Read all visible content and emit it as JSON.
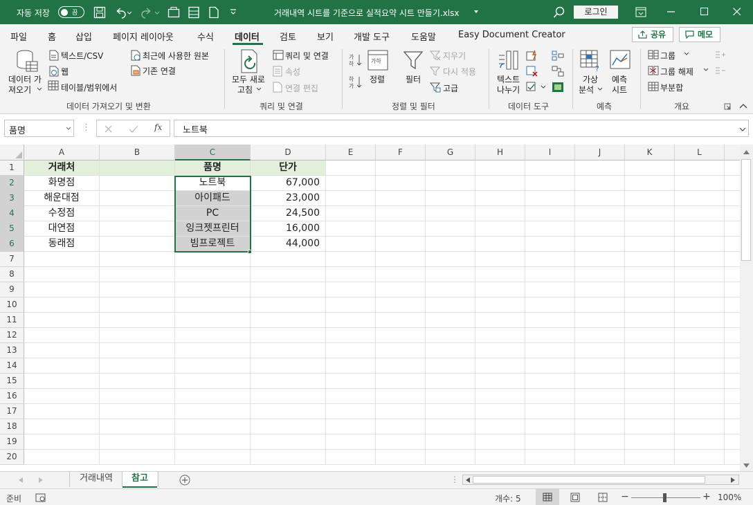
{
  "titlebar": {
    "autosave_label": "자동 저장",
    "toggle_label": "끔",
    "file_title": "거래내역 시트를 기준으로 실적요약 시트 만들기.xlsx",
    "login_label": "로그인"
  },
  "tabs": [
    "파일",
    "홈",
    "삽입",
    "페이지 레이아웃",
    "수식",
    "데이터",
    "검토",
    "보기",
    "개발 도구",
    "도움말",
    "Easy Document Creator"
  ],
  "active_tab": "데이터",
  "share_label": "공유",
  "memo_label": "메모",
  "ribbon": {
    "get_data": [
      "데이터 가",
      "져오기"
    ],
    "from_text": "텍스트/CSV",
    "from_web": "웹",
    "from_table": "테이블/범위에서",
    "recent_sources": "최근에 사용한 원본",
    "existing_connections": "기존 연결",
    "group_get": "데이터 가져오기 및 변환",
    "refresh_all": [
      "모두 새로",
      "고침"
    ],
    "queries_connections": "쿼리 및 연결",
    "properties": "속성",
    "edit_links": "연결 편집",
    "group_queries": "쿼리 및 연결",
    "sort": "정렬",
    "filter": "필터",
    "clear": "지우기",
    "reapply": "다시 적용",
    "advanced": "고급",
    "group_sort": "정렬 및 필터",
    "text_to_columns": [
      "텍스트",
      "나누기"
    ],
    "group_tools": "데이터 도구",
    "what_if": [
      "가상",
      "분석"
    ],
    "forecast_sheet": [
      "예측",
      "시트"
    ],
    "group_forecast": "예측",
    "group_btn": "그룹",
    "ungroup_btn": "그룹 해제",
    "subtotal": "부분합",
    "group_outline": "개요"
  },
  "formula_bar": {
    "name_box": "품명",
    "fx": "fx",
    "content": "노트북"
  },
  "columns": [
    "A",
    "B",
    "C",
    "D",
    "E",
    "F",
    "G",
    "H",
    "I",
    "J",
    "K",
    "L"
  ],
  "rows": [
    "1",
    "2",
    "3",
    "4",
    "5",
    "6",
    "7",
    "8",
    "9",
    "10",
    "11",
    "12",
    "13",
    "14",
    "15",
    "16",
    "17",
    "18",
    "19",
    "20"
  ],
  "sheet": {
    "headers": {
      "a": "거래처",
      "c": "품명",
      "d": "단가"
    },
    "data": [
      {
        "a": "화명점",
        "c": "노트북",
        "d": "67,000"
      },
      {
        "a": "해운대점",
        "c": "아이패드",
        "d": "23,000"
      },
      {
        "a": "수정점",
        "c": "PC",
        "d": "24,500"
      },
      {
        "a": "대연점",
        "c": "잉크젯프린터",
        "d": "16,000"
      },
      {
        "a": "동래점",
        "c": "빔프로젝트",
        "d": "44,000"
      }
    ]
  },
  "sheet_tabs": [
    "거래내역",
    "참고"
  ],
  "active_sheet": "참고",
  "status": {
    "mode": "준비",
    "count": "개수: 5",
    "zoom": "100%"
  }
}
